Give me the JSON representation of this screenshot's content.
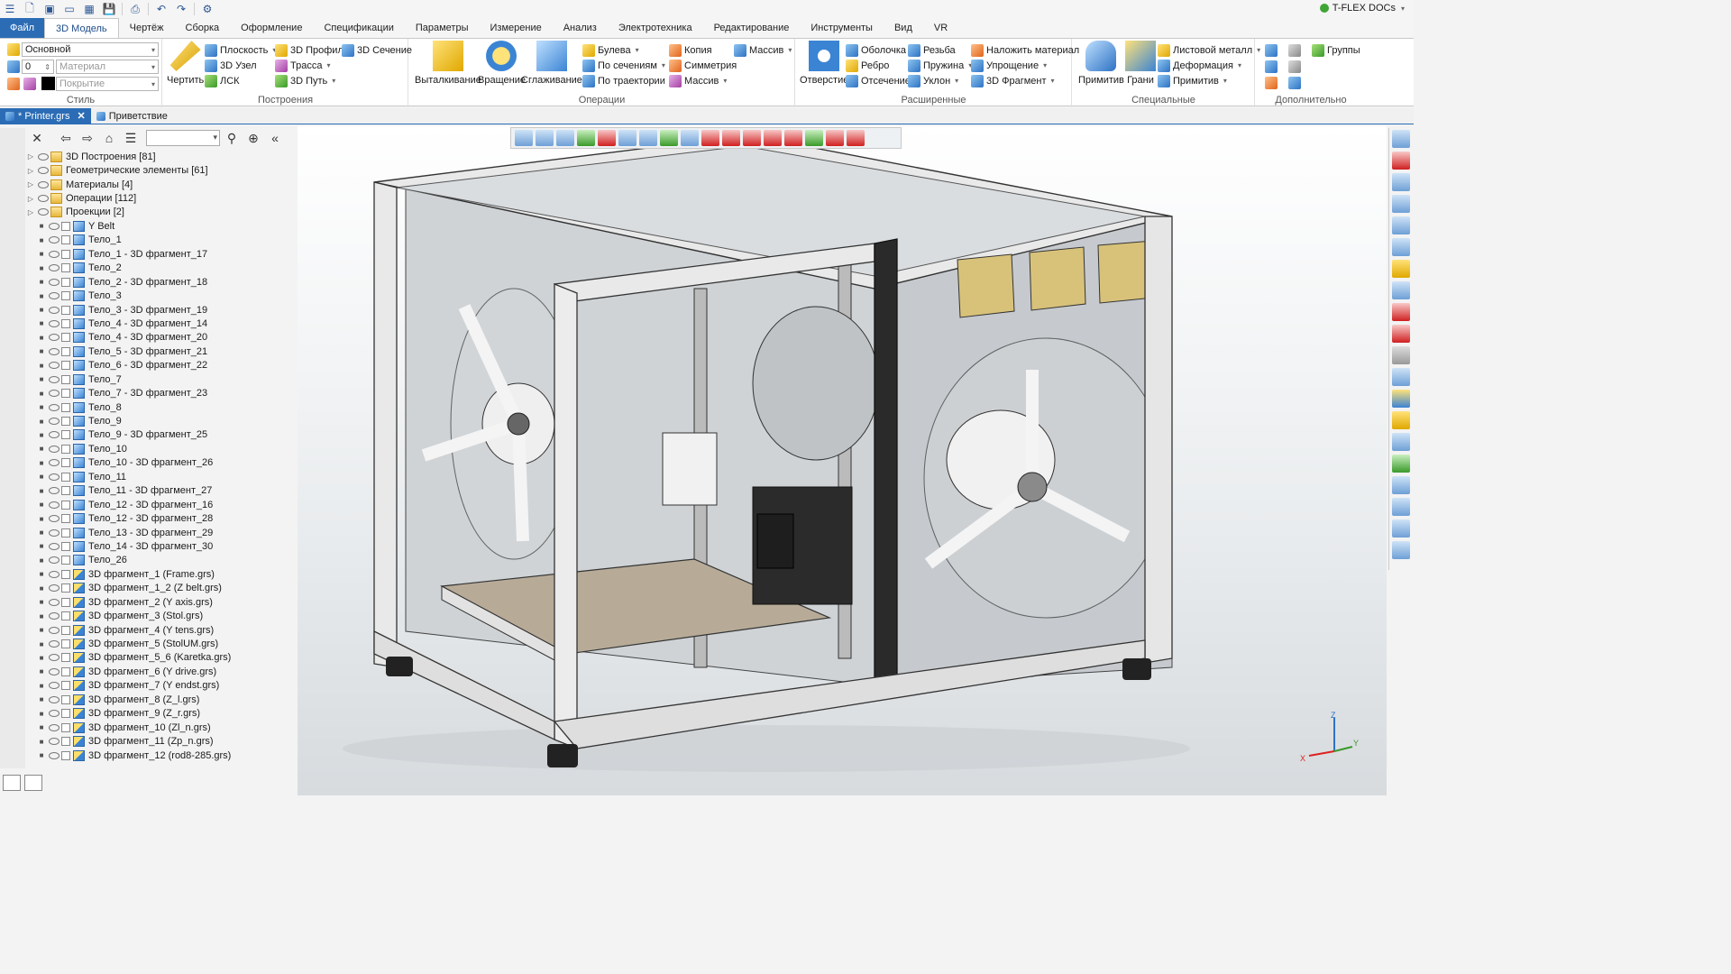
{
  "app": {
    "brand": "T-FLEX DOCs"
  },
  "ribbon_tabs": [
    "Файл",
    "3D Модель",
    "Чертёж",
    "Сборка",
    "Оформление",
    "Спецификации",
    "Параметры",
    "Измерение",
    "Анализ",
    "Электротехника",
    "Редактирование",
    "Инструменты",
    "Вид",
    "VR"
  ],
  "active_tab": "3D Модель",
  "ribbon": {
    "style": {
      "caption": "Стиль",
      "layer": "Основной",
      "level": "0",
      "material_placeholder": "Материал",
      "coating_placeholder": "Покрытие"
    },
    "constructions": {
      "caption": "Построения",
      "draw_label": "Чертить",
      "items": [
        "Плоскость",
        "3D Профиль",
        "3D Сечение",
        "3D Узел",
        "Трасса",
        "ЛСК",
        "3D Путь"
      ]
    },
    "operations": {
      "caption": "Операции",
      "extrude": "Выталкивание",
      "revolve": "Вращение",
      "smooth": "Сглаживание",
      "items": [
        "Булева",
        "Копия",
        "Массив",
        "По сечениям",
        "Симметрия",
        "По траектории",
        "Массив"
      ]
    },
    "advanced": {
      "caption": "Расширенные",
      "hole": "Отверстие",
      "items": [
        "Оболочка",
        "Резьба",
        "Наложить материал",
        "Ребро",
        "Пружина",
        "Упрощение",
        "Отсечение",
        "Уклон",
        "3D Фрагмент"
      ]
    },
    "special": {
      "caption": "Специальные",
      "primitive": "Примитив",
      "faces": "Грани",
      "items": [
        "Листовой металл",
        "Деформация",
        "Примитив"
      ]
    },
    "extra": {
      "caption": "Дополнительно",
      "groups": "Группы"
    }
  },
  "doc_tabs": [
    {
      "label": "* Printer.grs",
      "active": true
    },
    {
      "label": "Приветствие",
      "active": false
    }
  ],
  "tree": [
    {
      "label": "3D Построения [81]",
      "level": 0,
      "icon": "folder"
    },
    {
      "label": "Геометрические элементы [61]",
      "level": 0,
      "icon": "folder"
    },
    {
      "label": "Материалы [4]",
      "level": 0,
      "icon": "folder"
    },
    {
      "label": "Операции [112]",
      "level": 0,
      "icon": "folder"
    },
    {
      "label": "Проекции [2]",
      "level": 0,
      "icon": "folder"
    },
    {
      "label": "Y Belt",
      "level": 1,
      "icon": "body"
    },
    {
      "label": "Тело_1",
      "level": 1,
      "icon": "body"
    },
    {
      "label": "Тело_1 - 3D фрагмент_17",
      "level": 1,
      "icon": "body"
    },
    {
      "label": "Тело_2",
      "level": 1,
      "icon": "body"
    },
    {
      "label": "Тело_2 - 3D фрагмент_18",
      "level": 1,
      "icon": "body"
    },
    {
      "label": "Тело_3",
      "level": 1,
      "icon": "body"
    },
    {
      "label": "Тело_3 - 3D фрагмент_19",
      "level": 1,
      "icon": "body"
    },
    {
      "label": "Тело_4 - 3D фрагмент_14",
      "level": 1,
      "icon": "body"
    },
    {
      "label": "Тело_4 - 3D фрагмент_20",
      "level": 1,
      "icon": "body"
    },
    {
      "label": "Тело_5 - 3D фрагмент_21",
      "level": 1,
      "icon": "body"
    },
    {
      "label": "Тело_6 - 3D фрагмент_22",
      "level": 1,
      "icon": "body"
    },
    {
      "label": "Тело_7",
      "level": 1,
      "icon": "body"
    },
    {
      "label": "Тело_7 - 3D фрагмент_23",
      "level": 1,
      "icon": "body"
    },
    {
      "label": "Тело_8",
      "level": 1,
      "icon": "body"
    },
    {
      "label": "Тело_9",
      "level": 1,
      "icon": "body"
    },
    {
      "label": "Тело_9 - 3D фрагмент_25",
      "level": 1,
      "icon": "body"
    },
    {
      "label": "Тело_10",
      "level": 1,
      "icon": "body"
    },
    {
      "label": "Тело_10 - 3D фрагмент_26",
      "level": 1,
      "icon": "body"
    },
    {
      "label": "Тело_11",
      "level": 1,
      "icon": "body"
    },
    {
      "label": "Тело_11 - 3D фрагмент_27",
      "level": 1,
      "icon": "body"
    },
    {
      "label": "Тело_12 - 3D фрагмент_16",
      "level": 1,
      "icon": "body"
    },
    {
      "label": "Тело_12 - 3D фрагмент_28",
      "level": 1,
      "icon": "body"
    },
    {
      "label": "Тело_13 - 3D фрагмент_29",
      "level": 1,
      "icon": "body"
    },
    {
      "label": "Тело_14 - 3D фрагмент_30",
      "level": 1,
      "icon": "body"
    },
    {
      "label": "Тело_26",
      "level": 1,
      "icon": "body"
    },
    {
      "label": "3D фрагмент_1 (Frame.grs)",
      "level": 1,
      "icon": "frag"
    },
    {
      "label": "3D фрагмент_1_2 (Z belt.grs)",
      "level": 1,
      "icon": "frag"
    },
    {
      "label": "3D фрагмент_2 (Y axis.grs)",
      "level": 1,
      "icon": "frag"
    },
    {
      "label": "3D фрагмент_3 (Stol.grs)",
      "level": 1,
      "icon": "frag"
    },
    {
      "label": "3D фрагмент_4 (Y tens.grs)",
      "level": 1,
      "icon": "frag"
    },
    {
      "label": "3D фрагмент_5 (StolUM.grs)",
      "level": 1,
      "icon": "frag"
    },
    {
      "label": "3D фрагмент_5_6 (Karetka.grs)",
      "level": 1,
      "icon": "frag"
    },
    {
      "label": "3D фрагмент_6 (Y drive.grs)",
      "level": 1,
      "icon": "frag"
    },
    {
      "label": "3D фрагмент_7 (Y endst.grs)",
      "level": 1,
      "icon": "frag"
    },
    {
      "label": "3D фрагмент_8 (Z_l.grs)",
      "level": 1,
      "icon": "frag"
    },
    {
      "label": "3D фрагмент_9 (Z_r.grs)",
      "level": 1,
      "icon": "frag"
    },
    {
      "label": "3D фрагмент_10 (Zl_n.grs)",
      "level": 1,
      "icon": "frag"
    },
    {
      "label": "3D фрагмент_11 (Zp_n.grs)",
      "level": 1,
      "icon": "frag"
    },
    {
      "label": "3D фрагмент_12 (rod8-285.grs)",
      "level": 1,
      "icon": "frag"
    }
  ],
  "axes_triad": {
    "x": "X",
    "y": "Y",
    "z": "Z"
  },
  "colors": {
    "accent": "#2b6cb5",
    "frame": "#e9e9e9",
    "brass": "#d8c27a"
  }
}
